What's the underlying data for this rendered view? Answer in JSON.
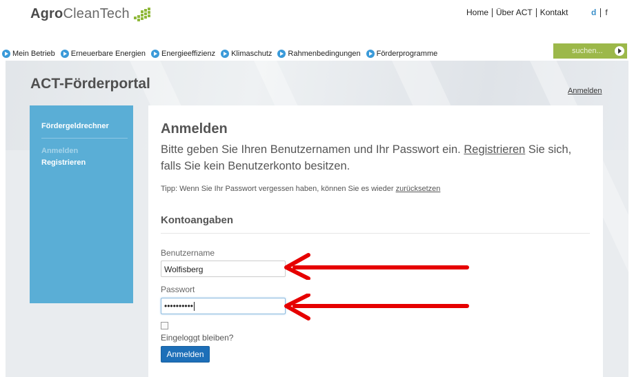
{
  "header": {
    "logo_bold": "Agro",
    "logo_light": "CleanTech",
    "nav": [
      "Home",
      "Über ACT",
      "Kontakt"
    ],
    "lang_d": "d",
    "lang_f": "f"
  },
  "mainnav": {
    "items": [
      "Mein Betrieb",
      "Erneuerbare Energien",
      "Energieeffizienz",
      "Klimaschutz",
      "Rahmenbedingungen",
      "Förderprogramme"
    ],
    "search_label": "suchen..."
  },
  "portal": {
    "title": "ACT-Förderportal",
    "login_link": "Anmelden"
  },
  "sidebar": {
    "heading": "Fördergeldrechner",
    "items": [
      "Anmelden",
      "Registrieren"
    ]
  },
  "main": {
    "heading": "Anmelden",
    "intro_before": "Bitte geben Sie Ihren Benutzernamen und Ihr Passwort ein. ",
    "intro_link": "Registrieren",
    "intro_after": " Sie sich, falls Sie kein Benutzerkonto besitzen.",
    "tip_before": "Tipp: Wenn Sie Ihr Passwort vergessen haben, können Sie es wieder ",
    "tip_link": "zurücksetzen",
    "section": "Kontoangaben",
    "username_label": "Benutzername",
    "username_value": "Wolfisberg",
    "password_label": "Passwort",
    "password_value": "••••••••••",
    "remember_label": "Eingeloggt bleiben?",
    "submit_label": "Anmelden"
  },
  "colors": {
    "accent_blue": "#5aaed6",
    "button_blue": "#1d6fb8",
    "search_green": "#9cb84a",
    "arrow_red": "#e60000"
  },
  "icons": [
    "logo-leaf-icon",
    "nav-arrow-icon",
    "search-go-icon",
    "red-arrow-icon"
  ]
}
